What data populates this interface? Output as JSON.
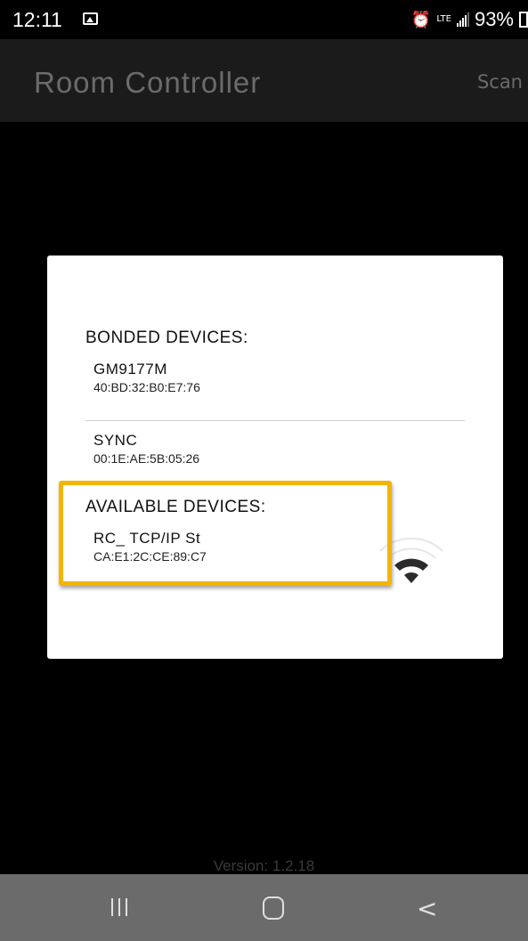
{
  "status_bar": {
    "time": "12:11",
    "network": "LTE",
    "battery": "93%"
  },
  "app_bar": {
    "title": "Room Controller",
    "scan_label": "Scan"
  },
  "dialog": {
    "bonded_label": "BONDED DEVICES:",
    "bonded_devices": [
      {
        "name": "GM9177M",
        "mac": "40:BD:32:B0:E7:76"
      },
      {
        "name": "SYNC",
        "mac": "00:1E:AE:5B:05:26"
      }
    ],
    "available_label": "AVAILABLE DEVICES:",
    "available_devices": [
      {
        "name": "RC_ TCP/IP St",
        "mac": "CA:E1:2C:CE:89:C7"
      }
    ]
  },
  "footer": {
    "version": "Version: 1.2.18"
  },
  "colors": {
    "highlight": "#f4b400",
    "app_bar_bg": "#1b1b1b",
    "nav_bg": "#6b6b6b"
  },
  "icons": [
    "image-icon",
    "alarm-icon",
    "signal-icon",
    "battery-icon",
    "wifi-scanning-icon",
    "recent-apps-icon",
    "home-icon",
    "back-icon"
  ]
}
